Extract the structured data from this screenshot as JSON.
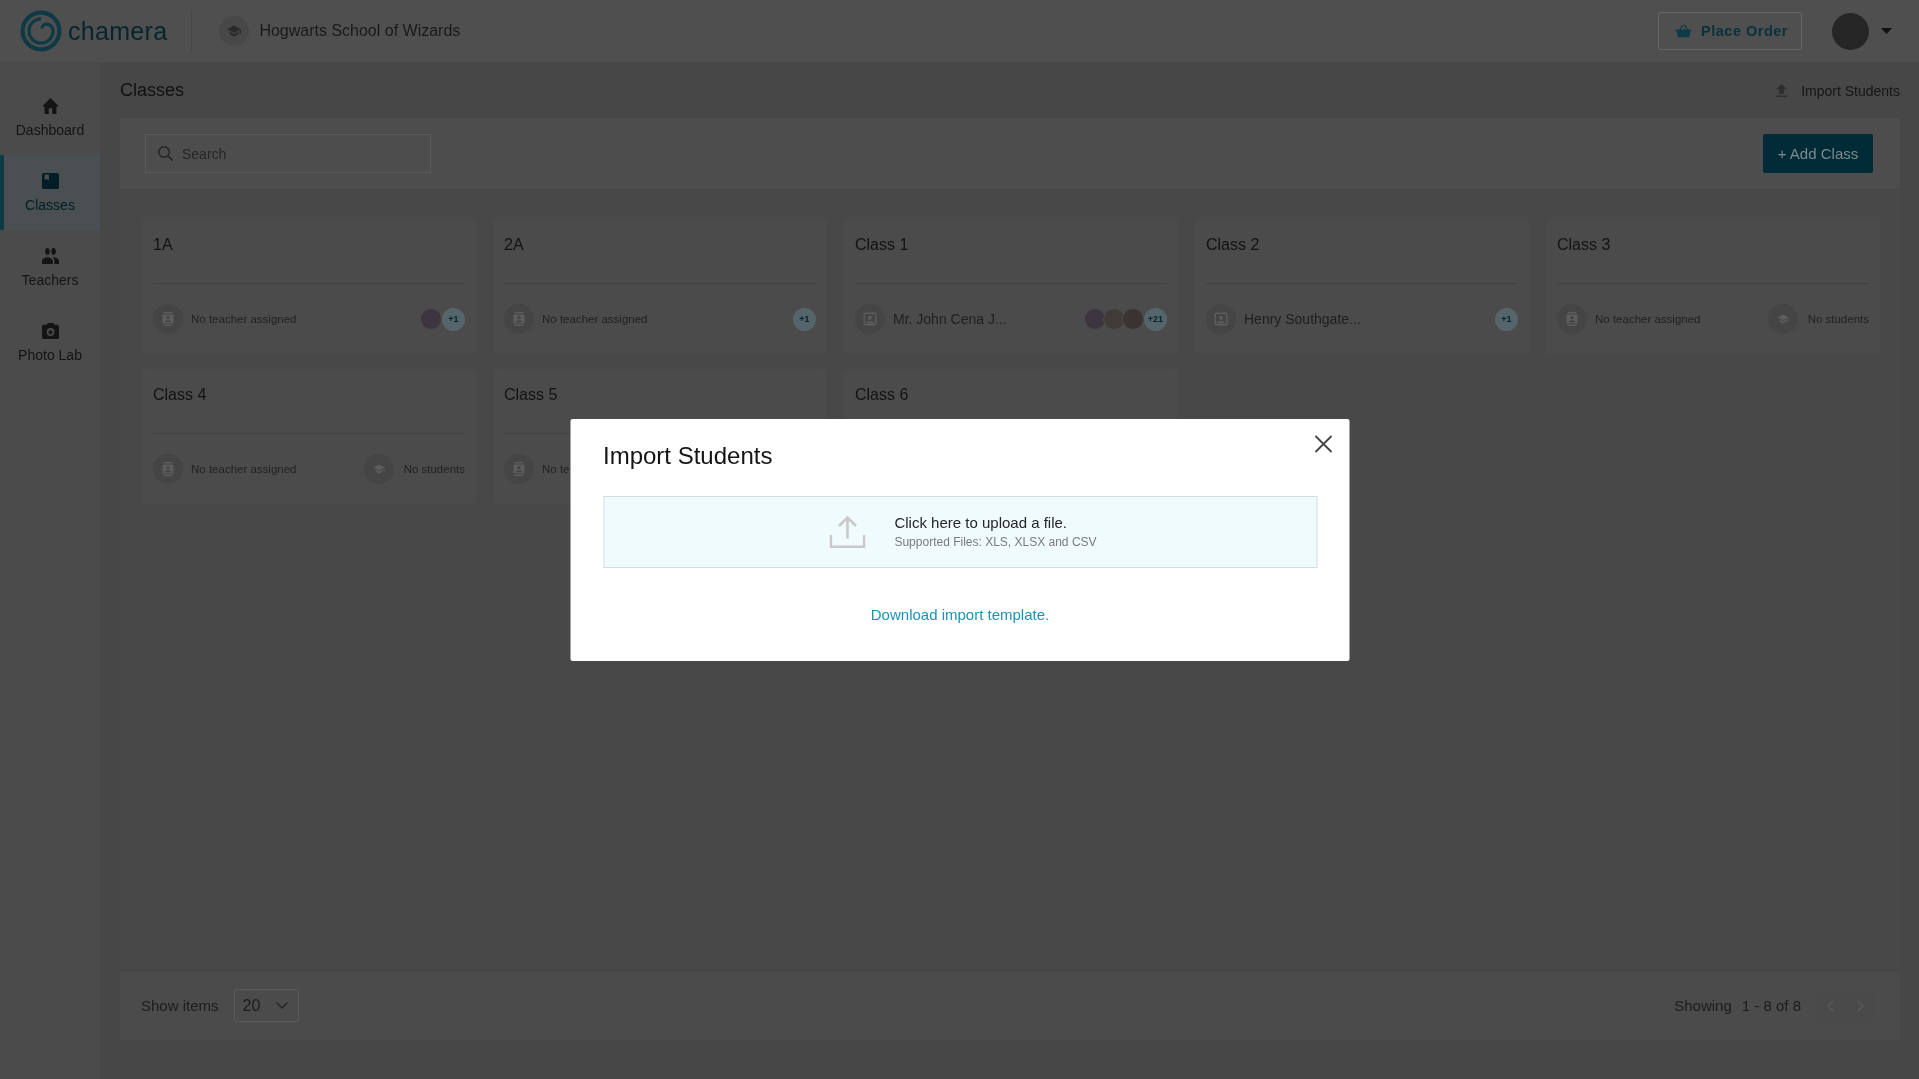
{
  "topbar": {
    "logo": "chamera",
    "school": "Hogwarts School of Wizards",
    "place_order": "Place Order"
  },
  "sidebar": {
    "items": [
      {
        "label": "Dashboard",
        "selected": false
      },
      {
        "label": "Classes",
        "selected": true
      },
      {
        "label": "Teachers",
        "selected": false
      },
      {
        "label": "Photo Lab",
        "selected": false
      }
    ]
  },
  "page": {
    "title": "Classes",
    "action": "Import Students"
  },
  "toolbar": {
    "search": {
      "placeholder": "Search"
    },
    "add_button": "+ Add Class"
  },
  "classes": [
    {
      "name": "1A",
      "teacher": {
        "kind": "none",
        "text": "No teacher assigned"
      },
      "students": {
        "kind": "avatars",
        "avatars": [
          {
            "kind": "photo"
          }
        ],
        "count": "+1"
      }
    },
    {
      "name": "2A",
      "teacher": {
        "kind": "none",
        "text": "No teacher assigned"
      },
      "students": {
        "kind": "avatars",
        "count": "+1"
      }
    },
    {
      "name": "Class 1",
      "teacher": {
        "kind": "assigned",
        "text": "Mr. John Cena J..."
      },
      "students": {
        "kind": "avatars",
        "avatars": [
          {
            "kind": "photo"
          },
          {
            "kind": "photo"
          },
          {
            "kind": "photo"
          }
        ],
        "count": "+21"
      }
    },
    {
      "name": "Class 2",
      "teacher": {
        "kind": "assigned",
        "text": "Henry Southgate..."
      },
      "students": {
        "kind": "avatars",
        "count": "+1"
      }
    },
    {
      "name": "Class 3",
      "teacher": {
        "kind": "none",
        "text": "No teacher assigned"
      },
      "students": {
        "kind": "none",
        "text": "No students"
      }
    },
    {
      "name": "Class 4",
      "teacher": {
        "kind": "none",
        "text": "No teacher assigned"
      },
      "students": {
        "kind": "none",
        "text": "No students"
      }
    },
    {
      "name": "Class 5",
      "teacher": {
        "kind": "none",
        "text": "No te"
      }
    },
    {
      "name": "Class 6"
    }
  ],
  "footer": {
    "show_items_label": "Show items",
    "page_size": "20",
    "showing_label": "Showing",
    "range": "1 - 8 of 8",
    "pager": [
      {
        "kind": "prev",
        "disabled": true
      },
      {
        "kind": "next",
        "disabled": true
      }
    ]
  },
  "modal": {
    "title": "Import Students",
    "upload_text": "Click here to upload a file.",
    "upload_hint": "Supported Files: XLS, XLSX and CSV",
    "template_link": "Download import template."
  }
}
